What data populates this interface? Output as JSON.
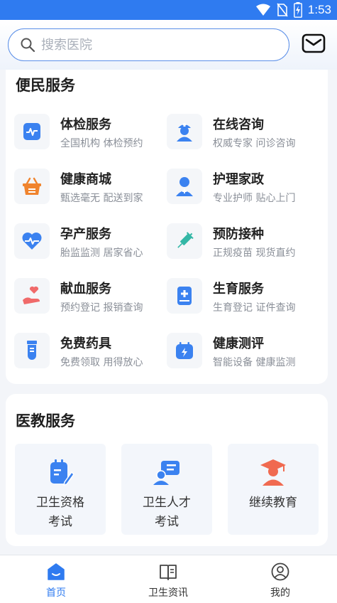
{
  "status_bar": {
    "time": "1:53",
    "icons": [
      "wifi-icon",
      "no-sim-icon",
      "battery-charging-icon"
    ]
  },
  "search": {
    "placeholder": "搜索医院",
    "value": ""
  },
  "header": {
    "mail_icon": "mail-icon"
  },
  "services": {
    "title": "便民服务",
    "items": [
      {
        "title": "体检服务",
        "subtitle": "全国机构 体检预约",
        "icon": "health-check-icon",
        "color": "#3b82f0"
      },
      {
        "title": "在线咨询",
        "subtitle": "权威专家 问诊咨询",
        "icon": "nurse-icon",
        "color": "#3b82f0"
      },
      {
        "title": "健康商城",
        "subtitle": "甄选毫无 配送到家",
        "icon": "shopping-basket-icon",
        "color": "#f0842e"
      },
      {
        "title": "护理家政",
        "subtitle": "专业护师 贴心上门",
        "icon": "caregiver-icon",
        "color": "#3b82f0"
      },
      {
        "title": "孕产服务",
        "subtitle": "胎监监测 居家省心",
        "icon": "heart-pulse-icon",
        "color": "#3b82f0"
      },
      {
        "title": "预防接种",
        "subtitle": "正规疫苗 现货直约",
        "icon": "syringe-icon",
        "color": "#34b7a6"
      },
      {
        "title": "献血服务",
        "subtitle": "预约登记 报销查询",
        "icon": "blood-donation-icon",
        "color": "#f06a6a"
      },
      {
        "title": "生育服务",
        "subtitle": "生育登记 证件查询",
        "icon": "medical-record-icon",
        "color": "#3b82f0"
      },
      {
        "title": "免费药具",
        "subtitle": "免费领取 用得放心",
        "icon": "medicine-bottle-icon",
        "color": "#3b82f0"
      },
      {
        "title": "健康测评",
        "subtitle": "智能设备 健康监测",
        "icon": "calendar-assess-icon",
        "color": "#3b82f0"
      }
    ]
  },
  "education": {
    "title": "医教服务",
    "items": [
      {
        "label": "卫生资格\n考试",
        "icon": "exam-edit-icon"
      },
      {
        "label": "卫生人才\n考试",
        "icon": "talent-card-icon"
      },
      {
        "label": "继续教育",
        "icon": "graduate-icon"
      }
    ]
  },
  "bottom_nav": {
    "items": [
      {
        "label": "首页",
        "icon": "home-icon",
        "active": true
      },
      {
        "label": "卫生资讯",
        "icon": "news-book-icon",
        "active": false
      },
      {
        "label": "我的",
        "icon": "profile-icon",
        "active": false
      }
    ]
  },
  "colors": {
    "primary": "#2f7bf0",
    "background": "#f3f5f9"
  }
}
